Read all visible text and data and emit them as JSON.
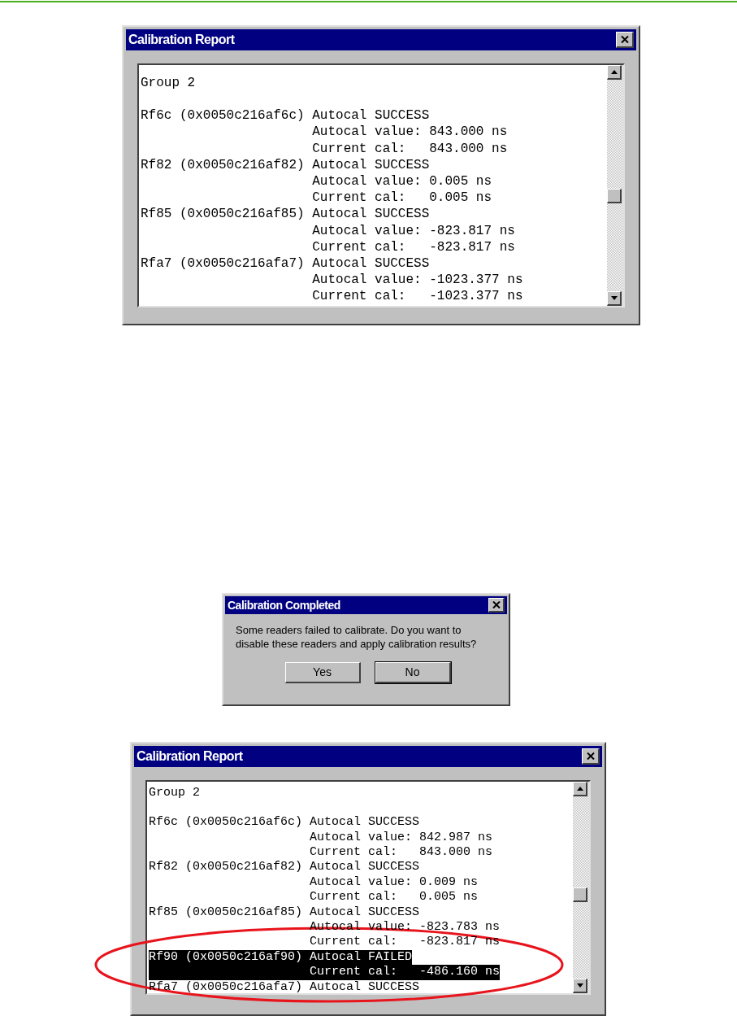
{
  "windows": [
    {
      "kind": "report",
      "title": "Calibration Report",
      "heading": "Group 2",
      "annotated": false,
      "lines": [
        {
          "kind": "reader",
          "text": "Rf6c (0x0050c216af6c) Autocal SUCCESS",
          "selected": false
        },
        {
          "kind": "detail",
          "text": "Autocal value: 843.000 ns",
          "selected": false
        },
        {
          "kind": "detail",
          "text": "Current cal:   843.000 ns",
          "selected": false
        },
        {
          "kind": "reader",
          "text": "Rf82 (0x0050c216af82) Autocal SUCCESS",
          "selected": false
        },
        {
          "kind": "detail",
          "text": "Autocal value: 0.005 ns",
          "selected": false
        },
        {
          "kind": "detail",
          "text": "Current cal:   0.005 ns",
          "selected": false
        },
        {
          "kind": "reader",
          "text": "Rf85 (0x0050c216af85) Autocal SUCCESS",
          "selected": false
        },
        {
          "kind": "detail",
          "text": "Autocal value: -823.817 ns",
          "selected": false
        },
        {
          "kind": "detail",
          "text": "Current cal:   -823.817 ns",
          "selected": false
        },
        {
          "kind": "reader",
          "text": "Rfa7 (0x0050c216afa7) Autocal SUCCESS",
          "selected": false
        },
        {
          "kind": "detail",
          "text": "Autocal value: -1023.377 ns",
          "selected": false
        },
        {
          "kind": "detail",
          "text": "Current cal:   -1023.377 ns",
          "selected": false
        }
      ]
    },
    {
      "kind": "dialog",
      "title": "Calibration Completed",
      "message": "Some readers failed to calibrate. Do you want to disable these readers and apply calibration results?",
      "buttons": [
        {
          "label": "Yes",
          "default": false
        },
        {
          "label": "No",
          "default": true
        }
      ]
    },
    {
      "kind": "report",
      "title": "Calibration Report",
      "heading": "Group 2",
      "annotated": true,
      "lines": [
        {
          "kind": "reader",
          "text": "Rf6c (0x0050c216af6c) Autocal SUCCESS",
          "selected": false
        },
        {
          "kind": "detail",
          "text": "Autocal value: 842.987 ns",
          "selected": false
        },
        {
          "kind": "detail",
          "text": "Current cal:   843.000 ns",
          "selected": false
        },
        {
          "kind": "reader",
          "text": "Rf82 (0x0050c216af82) Autocal SUCCESS",
          "selected": false
        },
        {
          "kind": "detail",
          "text": "Autocal value: 0.009 ns",
          "selected": false
        },
        {
          "kind": "detail",
          "text": "Current cal:   0.005 ns",
          "selected": false
        },
        {
          "kind": "reader",
          "text": "Rf85 (0x0050c216af85) Autocal SUCCESS",
          "selected": false
        },
        {
          "kind": "detail",
          "text": "Autocal value: -823.783 ns",
          "selected": false
        },
        {
          "kind": "detail",
          "text": "Current cal:   -823.817 ns",
          "selected": false
        },
        {
          "kind": "reader",
          "text": "Rf90 (0x0050c216af90) Autocal FAILED",
          "selected": true
        },
        {
          "kind": "detail",
          "text": "Current cal:   -486.160 ns",
          "selected": true
        },
        {
          "kind": "reader",
          "text": "Rfa7 (0x0050c216afa7) Autocal SUCCESS",
          "selected": false
        }
      ]
    }
  ]
}
